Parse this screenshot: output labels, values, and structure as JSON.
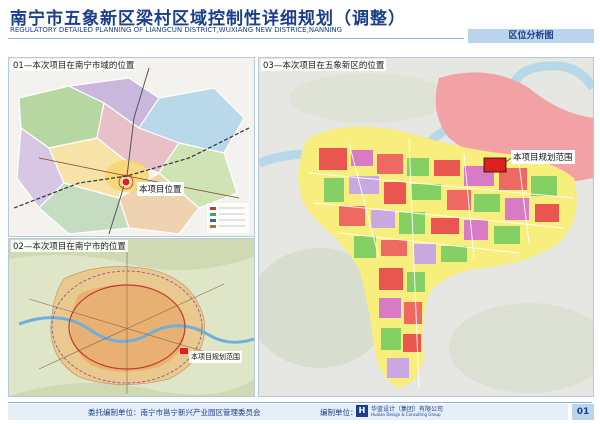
{
  "header": {
    "title": "南宁市五象新区梁村区域控制性详细规划（调整）",
    "subtitle": "REGULATORY DETAILED PLANNING OF LIANGCUN DISTRICT,WUXIANG NEW DISTRICE,NANNING",
    "section_tab": "区位分析图"
  },
  "panels": {
    "p1": {
      "label": "01—本次项目在南宁市域的位置",
      "callout": "本项目位置"
    },
    "p2": {
      "label": "02—本次项目在南宁市的位置",
      "callout": "本项目规划范围"
    },
    "p3": {
      "label": "03—本次项目在五象新区的位置",
      "callout": "本项目规划范围"
    }
  },
  "footer": {
    "commission": "委托编制单位：南宁市邕宁新兴产业园区管理委员会",
    "compiler": "编制单位：",
    "logo_cn": "华蓝设计（集团）有限公司",
    "logo_en": "Hualan Design & Consulting Group",
    "logo_mark": "H",
    "page_number": "01"
  },
  "colors": {
    "brand_blue": "#1b3e8c",
    "project_red": "#e02020"
  }
}
